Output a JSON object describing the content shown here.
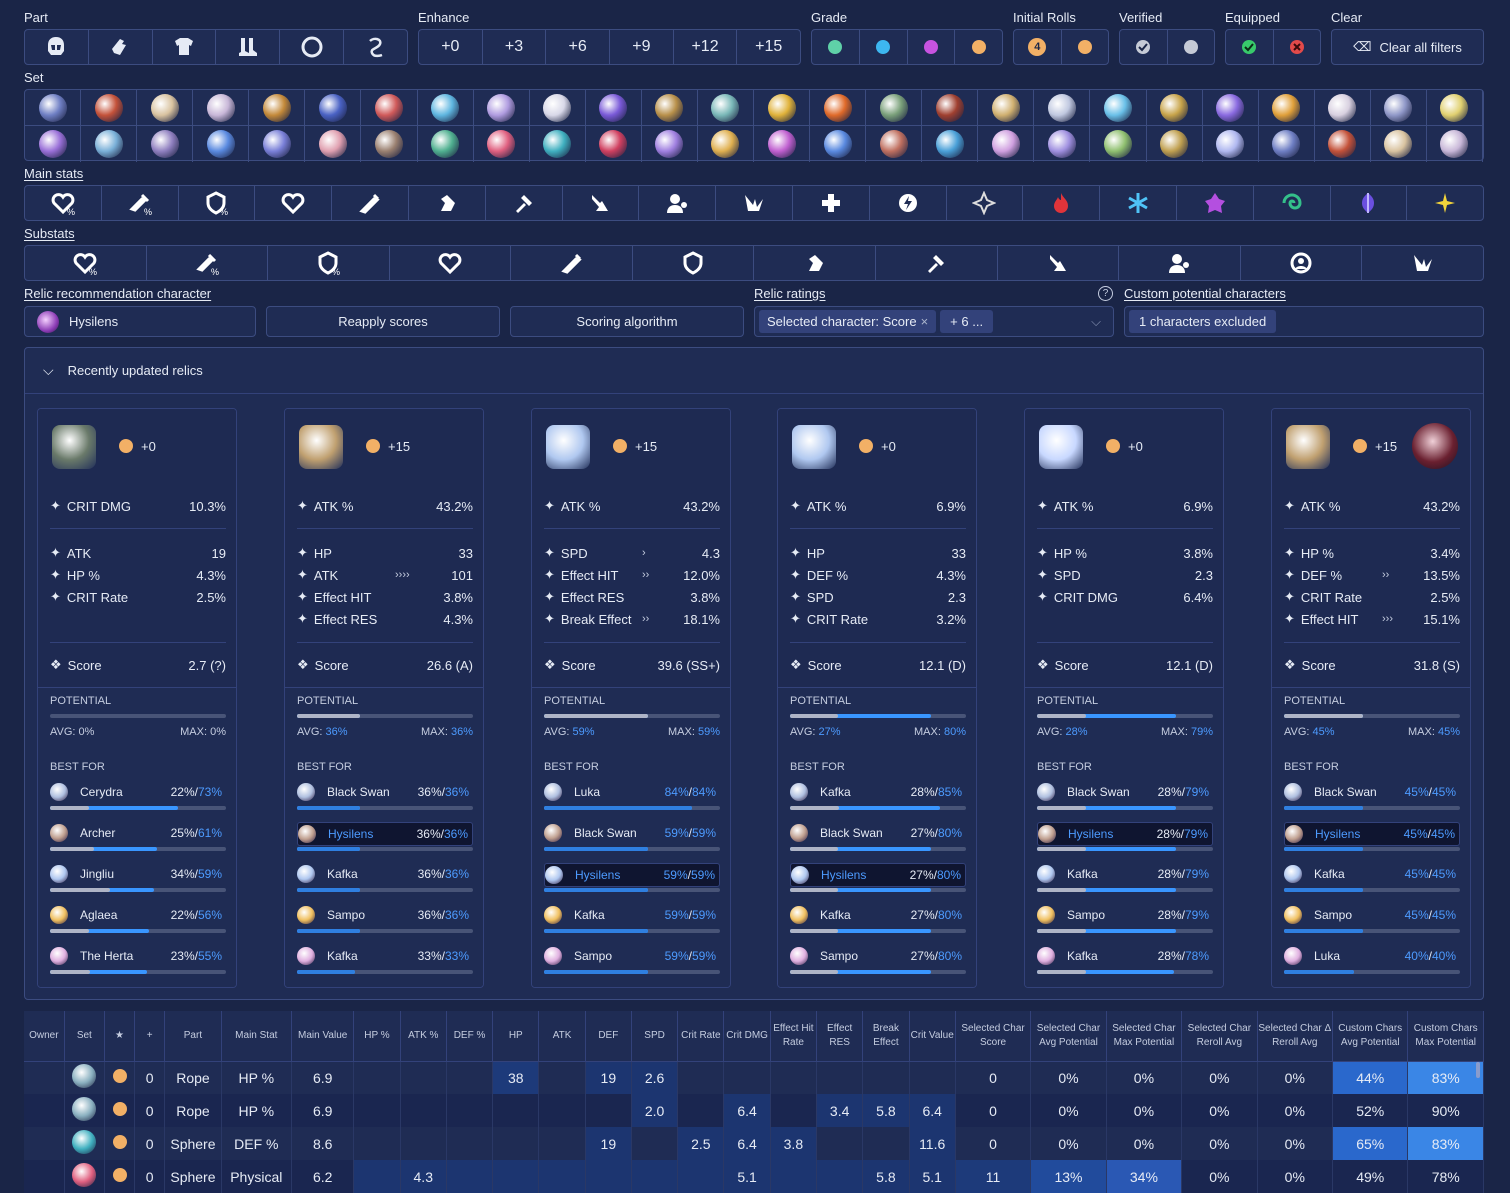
{
  "filters": {
    "part": {
      "label": "Part",
      "icons": [
        "head-icon",
        "hands-icon",
        "body-icon",
        "feet-icon",
        "sphere-icon",
        "rope-icon"
      ]
    },
    "enhance": {
      "label": "Enhance",
      "options": [
        "+0",
        "+3",
        "+6",
        "+9",
        "+12",
        "+15"
      ]
    },
    "grade": {
      "label": "Grade",
      "colors": [
        "#5fd1a8",
        "#3db7f0",
        "#c653e0",
        "#f2b066"
      ]
    },
    "initial_rolls": {
      "label": "Initial Rolls",
      "colors": [
        "#f2b066",
        "#f2b066"
      ],
      "first_glyph": "4"
    },
    "verified": {
      "label": "Verified"
    },
    "equipped": {
      "label": "Equipped"
    },
    "clear": {
      "label": "Clear",
      "button": "Clear all filters"
    },
    "set_label": "Set",
    "main_stats_label": "Main stats",
    "substats_label": "Substats"
  },
  "recommend": {
    "label": "Relic recommendation character",
    "character": "Hysilens",
    "reapply": "Reapply scores",
    "algorithm": "Scoring algorithm",
    "ratings_label": "Relic ratings",
    "rating_tag": "Selected character: Score",
    "rating_more": "+ 6 ...",
    "custom_label": "Custom potential characters",
    "custom_value": "1 characters excluded"
  },
  "panel": {
    "title": "Recently updated relics"
  },
  "common": {
    "score": "Score",
    "potential": "POTENTIAL",
    "best_for": "BEST FOR",
    "avg": "AVG:",
    "max": "MAX:"
  },
  "cards": [
    {
      "level": "+0",
      "main": {
        "name": "CRIT DMG",
        "value": "10.3%"
      },
      "subs": [
        {
          "name": "ATK",
          "value": "19",
          "ch": ""
        },
        {
          "name": "HP %",
          "value": "4.3%",
          "ch": ""
        },
        {
          "name": "CRIT Rate",
          "value": "2.5%",
          "ch": ""
        },
        {
          "name": "",
          "value": "",
          "ch": ""
        }
      ],
      "score": "2.7 (?)",
      "avg": "0%",
      "max": "0%",
      "avg_pct": 0,
      "max_pct": 0,
      "best": [
        {
          "name": "Cerydra",
          "cur": "22%",
          "max": "73%"
        },
        {
          "name": "Archer",
          "cur": "25%",
          "max": "61%"
        },
        {
          "name": "Jingliu",
          "cur": "34%",
          "max": "59%"
        },
        {
          "name": "Aglaea",
          "cur": "22%",
          "max": "56%"
        },
        {
          "name": "The Herta",
          "cur": "23%",
          "max": "55%"
        }
      ]
    },
    {
      "level": "+15",
      "main": {
        "name": "ATK %",
        "value": "43.2%"
      },
      "subs": [
        {
          "name": "HP",
          "value": "33",
          "ch": ""
        },
        {
          "name": "ATK",
          "value": "101",
          "ch": "››››"
        },
        {
          "name": "Effect HIT",
          "value": "3.8%",
          "ch": ""
        },
        {
          "name": "Effect RES",
          "value": "4.3%",
          "ch": ""
        }
      ],
      "score": "26.6 (A)",
      "avg": "36%",
      "max": "36%",
      "avg_pct": 36,
      "max_pct": 36,
      "best": [
        {
          "name": "Black Swan",
          "cur": "36%",
          "max": "36%"
        },
        {
          "name": "Hysilens",
          "cur": "36%",
          "max": "36%"
        },
        {
          "name": "Kafka",
          "cur": "36%",
          "max": "36%"
        },
        {
          "name": "Sampo",
          "cur": "36%",
          "max": "36%"
        },
        {
          "name": "Kafka",
          "cur": "33%",
          "max": "33%"
        }
      ]
    },
    {
      "level": "+15",
      "main": {
        "name": "ATK %",
        "value": "43.2%"
      },
      "subs": [
        {
          "name": "SPD",
          "value": "4.3",
          "ch": "›"
        },
        {
          "name": "Effect HIT",
          "value": "12.0%",
          "ch": "››"
        },
        {
          "name": "Effect RES",
          "value": "3.8%",
          "ch": ""
        },
        {
          "name": "Break Effect",
          "value": "18.1%",
          "ch": "››"
        }
      ],
      "score": "39.6 (SS+)",
      "avg": "59%",
      "max": "59%",
      "avg_pct": 59,
      "max_pct": 59,
      "best": [
        {
          "name": "Luka",
          "cur": "84%",
          "max": "84%"
        },
        {
          "name": "Black Swan",
          "cur": "59%",
          "max": "59%"
        },
        {
          "name": "Hysilens",
          "cur": "59%",
          "max": "59%"
        },
        {
          "name": "Kafka",
          "cur": "59%",
          "max": "59%"
        },
        {
          "name": "Sampo",
          "cur": "59%",
          "max": "59%"
        }
      ]
    },
    {
      "level": "+0",
      "main": {
        "name": "ATK %",
        "value": "6.9%"
      },
      "subs": [
        {
          "name": "HP",
          "value": "33",
          "ch": ""
        },
        {
          "name": "DEF %",
          "value": "4.3%",
          "ch": ""
        },
        {
          "name": "SPD",
          "value": "2.3",
          "ch": ""
        },
        {
          "name": "CRIT Rate",
          "value": "3.2%",
          "ch": ""
        }
      ],
      "score": "12.1 (D)",
      "avg": "27%",
      "max": "80%",
      "avg_pct": 27,
      "max_pct": 80,
      "best": [
        {
          "name": "Kafka",
          "cur": "28%",
          "max": "85%"
        },
        {
          "name": "Black Swan",
          "cur": "27%",
          "max": "80%"
        },
        {
          "name": "Hysilens",
          "cur": "27%",
          "max": "80%"
        },
        {
          "name": "Kafka",
          "cur": "27%",
          "max": "80%"
        },
        {
          "name": "Sampo",
          "cur": "27%",
          "max": "80%"
        }
      ]
    },
    {
      "level": "+0",
      "main": {
        "name": "ATK %",
        "value": "6.9%"
      },
      "subs": [
        {
          "name": "HP %",
          "value": "3.8%",
          "ch": ""
        },
        {
          "name": "SPD",
          "value": "2.3",
          "ch": ""
        },
        {
          "name": "CRIT DMG",
          "value": "6.4%",
          "ch": ""
        },
        {
          "name": "",
          "value": "",
          "ch": ""
        }
      ],
      "score": "12.1 (D)",
      "avg": "28%",
      "max": "79%",
      "avg_pct": 28,
      "max_pct": 79,
      "best": [
        {
          "name": "Black Swan",
          "cur": "28%",
          "max": "79%"
        },
        {
          "name": "Hysilens",
          "cur": "28%",
          "max": "79%"
        },
        {
          "name": "Kafka",
          "cur": "28%",
          "max": "79%"
        },
        {
          "name": "Sampo",
          "cur": "28%",
          "max": "79%"
        },
        {
          "name": "Kafka",
          "cur": "28%",
          "max": "78%"
        }
      ]
    },
    {
      "level": "+15",
      "main": {
        "name": "ATK %",
        "value": "43.2%"
      },
      "subs": [
        {
          "name": "HP %",
          "value": "3.4%",
          "ch": ""
        },
        {
          "name": "DEF %",
          "value": "13.5%",
          "ch": "››"
        },
        {
          "name": "CRIT Rate",
          "value": "2.5%",
          "ch": ""
        },
        {
          "name": "Effect HIT",
          "value": "15.1%",
          "ch": "›››"
        }
      ],
      "score": "31.8 (S)",
      "avg": "45%",
      "max": "45%",
      "avg_pct": 45,
      "max_pct": 45,
      "best": [
        {
          "name": "Black Swan",
          "cur": "45%",
          "max": "45%"
        },
        {
          "name": "Hysilens",
          "cur": "45%",
          "max": "45%"
        },
        {
          "name": "Kafka",
          "cur": "45%",
          "max": "45%"
        },
        {
          "name": "Sampo",
          "cur": "45%",
          "max": "45%"
        },
        {
          "name": "Luka",
          "cur": "40%",
          "max": "40%"
        }
      ]
    }
  ],
  "table": {
    "headers": [
      "Owner",
      "Set",
      "★",
      "+",
      "Part",
      "Main Stat",
      "Main Value",
      "HP %",
      "ATK %",
      "DEF %",
      "HP",
      "ATK",
      "DEF",
      "SPD",
      "Crit Rate",
      "Crit DMG",
      "Effect Hit Rate",
      "Effect RES",
      "Break Effect",
      "Crit Value",
      "Selected Char Score",
      "Selected Char Avg Potential",
      "Selected Char Max Potential",
      "Selected Char Reroll Avg",
      "Selected Char Δ Reroll Avg",
      "Custom Chars Avg Potential",
      "Custom Chars Max Potential"
    ],
    "rows": [
      [
        "",
        "",
        "",
        "0",
        "Rope",
        "HP %",
        "6.9",
        "",
        "",
        "",
        "38",
        "",
        "19",
        "2.6",
        "",
        "",
        "",
        "",
        "",
        "",
        "0",
        "0%",
        "0%",
        "0%",
        "0%",
        "44%",
        "83%"
      ],
      [
        "",
        "",
        "",
        "0",
        "Rope",
        "HP %",
        "6.9",
        "",
        "",
        "",
        "",
        "",
        "",
        "2.0",
        "",
        "6.4",
        "",
        "3.4",
        "5.8",
        "6.4",
        "0",
        "0%",
        "0%",
        "0%",
        "0%",
        "52%",
        "90%"
      ],
      [
        "",
        "",
        "",
        "0",
        "Sphere",
        "DEF %",
        "8.6",
        "",
        "",
        "",
        "",
        "",
        "19",
        "",
        "2.5",
        "6.4",
        "3.8",
        "",
        "",
        "11.6",
        "0",
        "0%",
        "0%",
        "0%",
        "0%",
        "65%",
        "83%"
      ],
      [
        "",
        "",
        "",
        "0",
        "Sphere",
        "Physical",
        "6.2",
        "",
        "4.3",
        "",
        "",
        "",
        "",
        "",
        "",
        "5.1",
        "",
        "",
        "5.8",
        "5.1",
        "11",
        "13%",
        "34%",
        "0%",
        "0%",
        "49%",
        "78%"
      ]
    ]
  }
}
